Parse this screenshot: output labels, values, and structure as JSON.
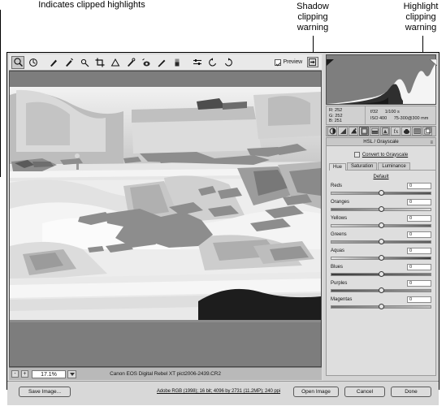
{
  "annotations": {
    "shadow": "Shadow\nclipping\nwarning",
    "shadow_l1": "Shadow",
    "shadow_l2": "clipping",
    "shadow_l3": "warning",
    "highlight_l1": "Highlight",
    "highlight_l2": "clipping",
    "highlight_l3": "warning",
    "bottom": "Indicates clipped highlights"
  },
  "toolbar": {
    "tools": [
      {
        "name": "zoom-tool",
        "selected": true
      },
      {
        "name": "hand-tool",
        "selected": false
      },
      {
        "name": "white-balance-tool",
        "selected": false
      },
      {
        "name": "color-sampler-tool",
        "selected": false
      },
      {
        "name": "targeted-adjustment-tool",
        "selected": false
      },
      {
        "name": "crop-tool",
        "selected": false
      },
      {
        "name": "straighten-tool",
        "selected": false
      },
      {
        "name": "spot-removal-tool",
        "selected": false
      },
      {
        "name": "red-eye-removal-tool",
        "selected": false
      },
      {
        "name": "adjustment-brush-tool",
        "selected": false
      },
      {
        "name": "graduated-filter-tool",
        "selected": false
      },
      {
        "name": "open-preferences-tool",
        "selected": false
      },
      {
        "name": "rotate-counterclockwise-tool",
        "selected": false
      },
      {
        "name": "rotate-clockwise-tool",
        "selected": false
      }
    ],
    "preview_label": "Preview",
    "preview_checked": true,
    "fullscreen_label": "Full Screen Mode"
  },
  "status": {
    "zoom_minus": "-",
    "zoom_plus": "+",
    "zoom_value": "17.1%",
    "file_info": "Canon EOS Digital Rebel XT    pict2006-2439.CR2"
  },
  "histogram": {
    "clip_shadow_icon": "shadow-clipping-triangle",
    "clip_highlight_icon": "highlight-clipping-triangle",
    "rgb": {
      "r_label": "R:",
      "r_value": "252",
      "g_label": "G:",
      "g_value": "252",
      "b_label": "B:",
      "b_value": "251"
    },
    "exif": {
      "aperture": "f/32",
      "shutter": "1/100 s",
      "iso": "ISO 400",
      "lens": "75-300@300 mm"
    }
  },
  "panel": {
    "tabs": [
      {
        "name": "tab-basic",
        "active": false
      },
      {
        "name": "tab-tone-curve",
        "active": false
      },
      {
        "name": "tab-detail",
        "active": false
      },
      {
        "name": "tab-hsl-grayscale",
        "active": true
      },
      {
        "name": "tab-split-toning",
        "active": false
      },
      {
        "name": "tab-lens-corrections",
        "active": false
      },
      {
        "name": "tab-camera-calibration",
        "active": false
      },
      {
        "name": "tab-presets",
        "active": false
      },
      {
        "name": "tab-snapshots",
        "active": false
      },
      {
        "name": "tab-effects",
        "active": false
      }
    ],
    "title": "HSL / Grayscale",
    "menu_glyph": "≡",
    "convert_to_grayscale": "Convert to Grayscale",
    "convert_checked": false,
    "hsl_tabs": [
      {
        "label": "Hue",
        "active": true
      },
      {
        "label": "Saturation",
        "active": false
      },
      {
        "label": "Luminance",
        "active": false
      }
    ],
    "default_link": "Default",
    "sliders": [
      {
        "label": "Reds",
        "value": "0"
      },
      {
        "label": "Oranges",
        "value": "0"
      },
      {
        "label": "Yellows",
        "value": "0"
      },
      {
        "label": "Greens",
        "value": "0"
      },
      {
        "label": "Aquas",
        "value": "0"
      },
      {
        "label": "Blues",
        "value": "0"
      },
      {
        "label": "Purples",
        "value": "0"
      },
      {
        "label": "Magentas",
        "value": "0"
      }
    ]
  },
  "footer": {
    "save_label": "Save Image...",
    "workflow_info": "Adobe RGB (1998); 16 bit; 4096 by 2731 (11.2MP); 240 ppi",
    "open_label": "Open Image",
    "cancel_label": "Cancel",
    "done_label": "Done"
  }
}
